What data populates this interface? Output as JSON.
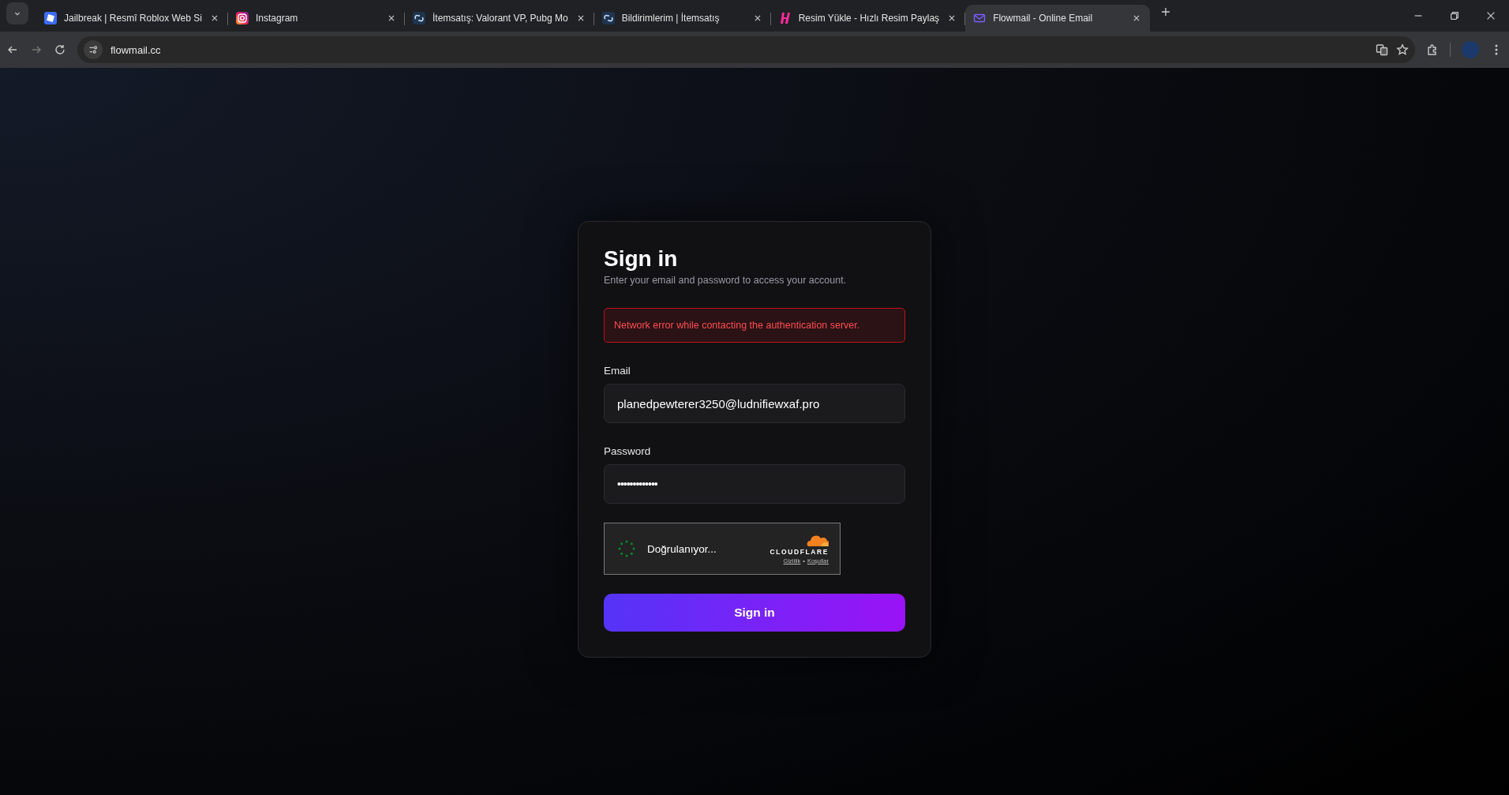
{
  "browser": {
    "tabs": [
      {
        "title": "Jailbreak | Resmî Roblox Web Si",
        "kind": "square",
        "selected": false
      },
      {
        "title": "Instagram",
        "kind": "camera",
        "selected": false
      },
      {
        "title": "İtemsatış: Valorant VP, Pubg Mo",
        "kind": "chain",
        "selected": false
      },
      {
        "title": "Bildirimlerim | İtemsatış",
        "kind": "chain",
        "selected": false
      },
      {
        "title": "Resim Yükle - Hızlı Resim Paylaş",
        "kind": "letter",
        "selected": false
      },
      {
        "title": "Flowmail - Online Email",
        "kind": "envelope",
        "selected": true
      }
    ],
    "address": "flowmail.cc"
  },
  "card": {
    "title": "Sign in",
    "subtitle": "Enter your email and password to access your account.",
    "error": "Network error while contacting the authentication server.",
    "fields": [
      {
        "label": "Email",
        "value": "planedpewterer3250@ludnifiewxaf.pro",
        "kind": "text"
      },
      {
        "label": "Password",
        "value": "•••••••••••••",
        "kind": "password"
      }
    ],
    "captcha": {
      "status": "Doğrulanıyor...",
      "brand": "CLOUDFLARE",
      "links": [
        "Gizlilik",
        "Koşullar"
      ],
      "separator": "•"
    },
    "button": "Sign in"
  }
}
